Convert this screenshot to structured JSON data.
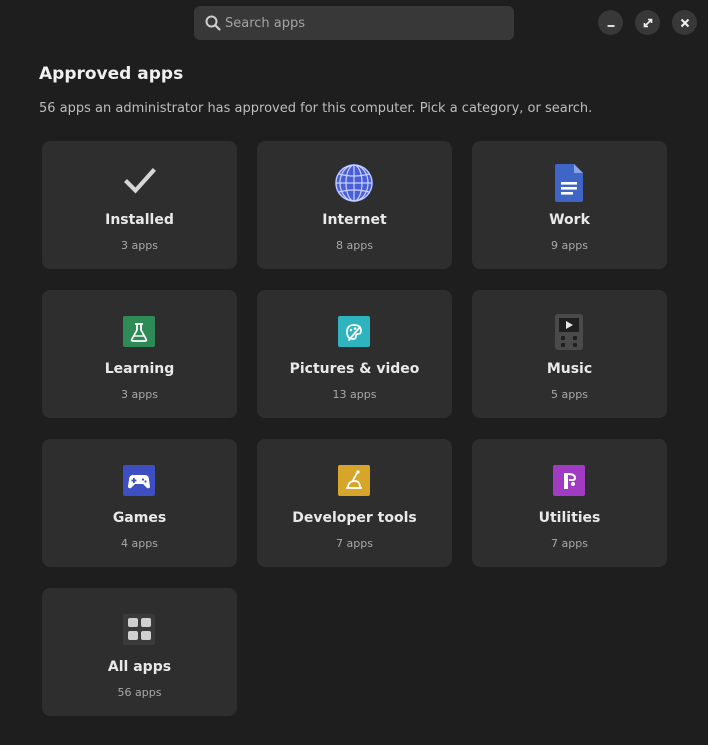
{
  "search": {
    "placeholder": "Search apps",
    "icon": "search-icon"
  },
  "window_controls": {
    "minimize": "minimize-icon",
    "maximize": "maximize-icon",
    "close": "close-icon"
  },
  "header": {
    "title": "Approved apps",
    "subtitle": "56 apps an administrator has approved for this computer. Pick a category, or search."
  },
  "categories": [
    {
      "label": "Installed",
      "count": "3 apps",
      "icon": "checkmark-icon"
    },
    {
      "label": "Internet",
      "count": "8 apps",
      "icon": "globe-icon",
      "color": "#4a5fd6"
    },
    {
      "label": "Work",
      "count": "9 apps",
      "icon": "document-icon",
      "color": "#3f66c7"
    },
    {
      "label": "Learning",
      "count": "3 apps",
      "icon": "flask-icon",
      "color": "#2e8b57"
    },
    {
      "label": "Pictures & video",
      "count": "13 apps",
      "icon": "palette-icon",
      "color": "#2fb3bf"
    },
    {
      "label": "Music",
      "count": "5 apps",
      "icon": "music-player-icon",
      "color": "#4a4a4a"
    },
    {
      "label": "Games",
      "count": "4 apps",
      "icon": "gamepad-icon",
      "color": "#3d4fc2"
    },
    {
      "label": "Developer tools",
      "count": "7 apps",
      "icon": "lab-tool-icon",
      "color": "#d6a52a"
    },
    {
      "label": "Utilities",
      "count": "7 apps",
      "icon": "tools-icon",
      "color": "#a23bc4"
    },
    {
      "label": "All apps",
      "count": "56 apps",
      "icon": "grid-icon"
    }
  ]
}
